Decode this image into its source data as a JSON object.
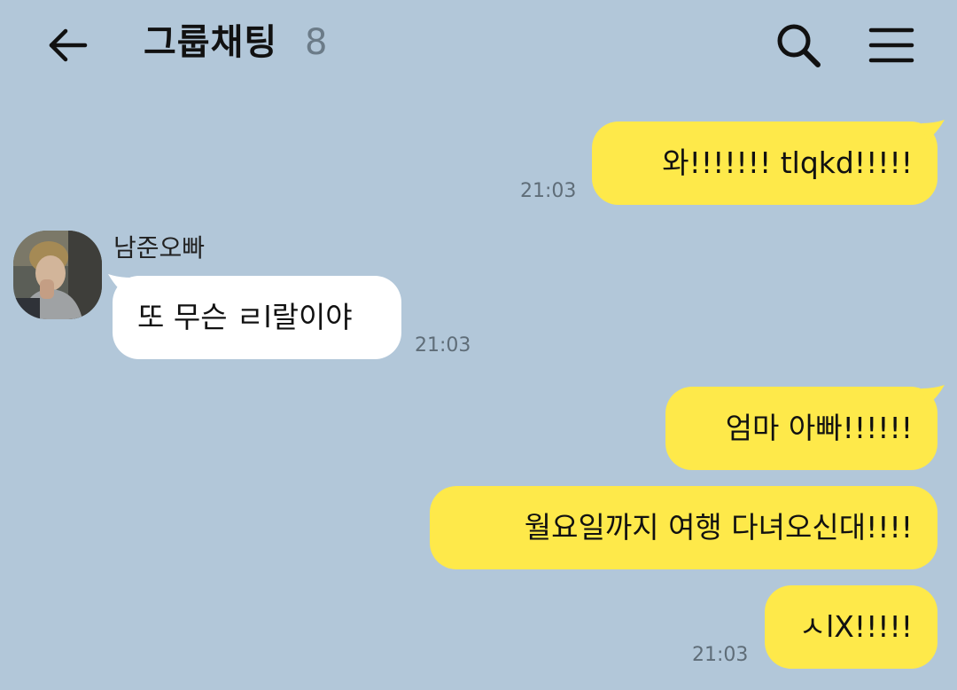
{
  "header": {
    "title": "그룹채팅",
    "member_count": "8",
    "back_icon": "arrow-left-icon",
    "search_icon": "search-icon",
    "menu_icon": "hamburger-menu-icon"
  },
  "colors": {
    "background": "#b2c7d9",
    "my_bubble": "#fee94a",
    "their_bubble": "#ffffff",
    "timestamp": "#5f6d78"
  },
  "messages": [
    {
      "sender": "me",
      "text": "와!!!!!!! tlqkd!!!!!",
      "time": "21:03"
    },
    {
      "sender": "남준오빠",
      "text": "또 무슨 ㄹl랄이야",
      "time": "21:03"
    },
    {
      "sender": "me",
      "text": "엄마 아빠!!!!!!",
      "time": ""
    },
    {
      "sender": "me",
      "text": "월요일까지 여행 다녀오신대!!!!",
      "time": ""
    },
    {
      "sender": "me",
      "text": "ㅅlX!!!!!",
      "time": "21:03"
    }
  ]
}
